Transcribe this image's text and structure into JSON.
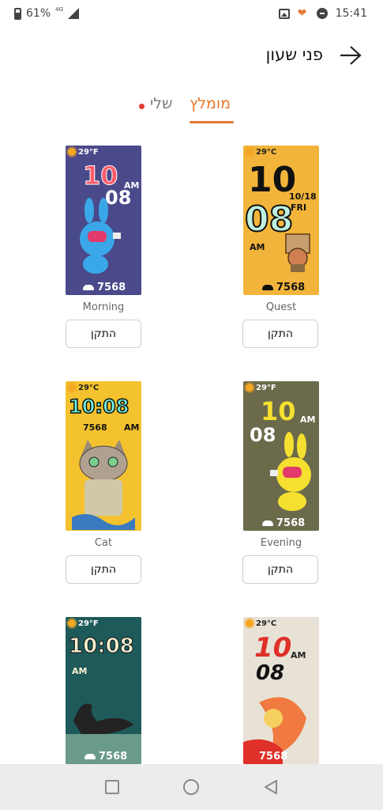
{
  "status_bar": {
    "battery": "61%",
    "network": "4G",
    "time": "15:41"
  },
  "header": {
    "title": "פני שעון",
    "back_icon": "arrow-right-icon"
  },
  "tabs": {
    "recommended": "מומלץ",
    "mine": "שלי"
  },
  "faces": [
    {
      "name": "Quest",
      "install": "התקן",
      "temp": "29°C",
      "hour": "10",
      "minute": "08",
      "date": "10/18",
      "day": "FRI",
      "ampm": "AM",
      "steps": "7568",
      "bg": "#f2b43a"
    },
    {
      "name": "Morning",
      "install": "התקן",
      "temp": "29°F",
      "hour": "10",
      "minute": "08",
      "ampm": "AM",
      "steps": "7568",
      "bg": "#4a4a8a"
    },
    {
      "name": "Evening",
      "install": "התקן",
      "temp": "29°F",
      "hour": "10",
      "minute": "08",
      "ampm": "AM",
      "steps": "7568",
      "bg": "#6b6a4a"
    },
    {
      "name": "Cat",
      "install": "התקן",
      "temp": "29°C",
      "time": "10:08",
      "ampm": "AM",
      "steps": "7568",
      "bg": "#f4c22e"
    },
    {
      "temp": "29°C",
      "hour": "10",
      "minute": "08",
      "ampm": "AM",
      "steps": "7568",
      "bg": "#e8e2d6"
    },
    {
      "temp": "29°F",
      "time": "10:08",
      "ampm": "AM",
      "steps": "7568",
      "bg": "#1f5a5a"
    }
  ],
  "colors": {
    "accent": "#e7772e",
    "dot": "#e33b2f"
  }
}
